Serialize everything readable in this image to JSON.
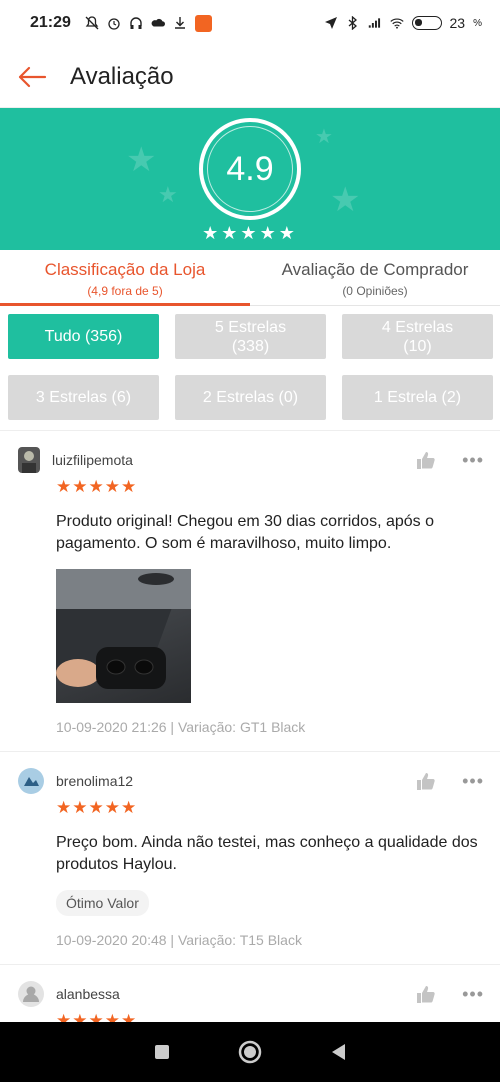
{
  "status_bar": {
    "time": "21:29",
    "battery": "23"
  },
  "header": {
    "title": "Avaliação",
    "back_icon": "arrow-left-icon",
    "accent": "#e8552d"
  },
  "hero": {
    "score": "4.9",
    "stars": "★★★★★",
    "bg": "#1fbf9f"
  },
  "tabs": [
    {
      "label": "Classificação da Loja",
      "sub": "(4,9 fora de 5)",
      "active": true
    },
    {
      "label": "Avaliação de Comprador",
      "sub": "(0 Opiniões)",
      "active": false
    }
  ],
  "filters": [
    {
      "label": "Tudo (356)",
      "active": true
    },
    {
      "label": "5 Estrelas (338)",
      "active": false
    },
    {
      "label": "4 Estrelas (10)",
      "active": false
    },
    {
      "label": "3 Estrelas (6)",
      "active": false
    },
    {
      "label": "2 Estrelas (0)",
      "active": false
    },
    {
      "label": "1 Estrela (2)",
      "active": false
    }
  ],
  "reviews": [
    {
      "user": "luizfilipemota",
      "stars": "★★★★★",
      "text": "Produto original! Chegou em 30 dias corridos, após o pagamento. O som é maravilhoso, muito limpo.",
      "meta": "10-09-2020 21:26 | Variação: GT1 Black"
    },
    {
      "user": "brenolima12",
      "stars": "★★★★★",
      "text": "Preço bom. Ainda não testei, mas conheço a qualidade dos produtos Haylou.",
      "tag": "Ótimo Valor",
      "meta": "10-09-2020 20:48 | Variação: T15 Black"
    },
    {
      "user": "alanbessa",
      "stars": "★★★★★"
    }
  ]
}
